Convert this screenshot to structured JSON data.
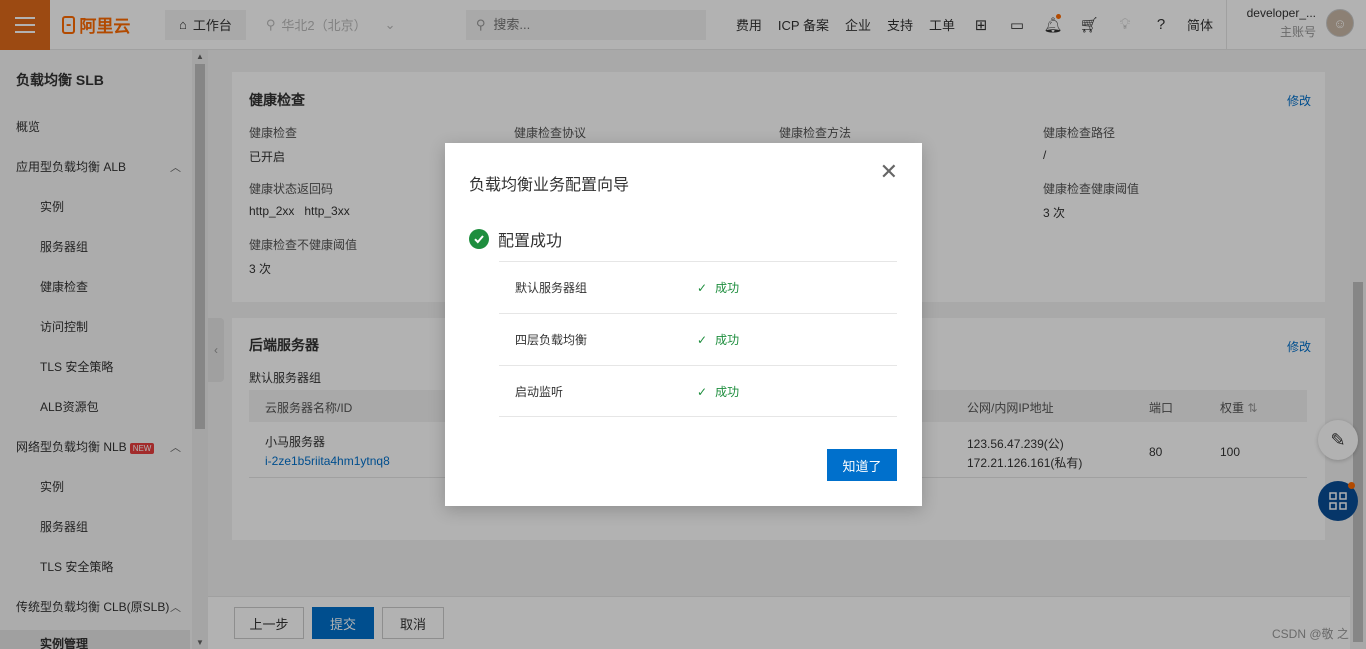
{
  "topbar": {
    "logo_text": "阿里云",
    "workbench_label": "工作台",
    "region_label": "华北2（北京）",
    "search_placeholder": "搜索...",
    "links": [
      "费用",
      "ICP 备案",
      "企业",
      "支持",
      "工单"
    ],
    "lang_label": "简体",
    "username": "developer_...",
    "account_type": "主账号",
    "accent_color": "#e06a1b"
  },
  "sidebar": {
    "title": "负载均衡 SLB",
    "overview": "概览",
    "alb_group": "应用型负载均衡 ALB",
    "alb_items": [
      "实例",
      "服务器组",
      "健康检查",
      "访问控制",
      "TLS 安全策略",
      "ALB资源包"
    ],
    "nlb_group": "网络型负载均衡 NLB",
    "nlb_badge": "NEW",
    "nlb_items": [
      "实例",
      "服务器组",
      "TLS 安全策略"
    ],
    "clb_group": "传统型负载均衡 CLB(原SLB)",
    "clb_active_item": "实例管理"
  },
  "health": {
    "title": "健康检查",
    "edit": "修改",
    "fields": [
      {
        "label": "健康检查",
        "value": "已开启"
      },
      {
        "label": "健康检查协议",
        "value": ""
      },
      {
        "label": "健康检查方法",
        "value": ""
      },
      {
        "label": "健康检查路径",
        "value": "/"
      },
      {
        "label": "健康状态返回码",
        "value": "http_2xx   http_3xx"
      },
      {
        "label": "健康检查健康阈值",
        "value": "3 次"
      },
      {
        "label": "健康检查不健康阈值",
        "value": "3 次"
      }
    ]
  },
  "backend": {
    "title": "后端服务器",
    "edit": "修改",
    "group_label": "默认服务器组",
    "columns": [
      "云服务器名称/ID",
      "公网/内网IP地址",
      "端口",
      "权重"
    ],
    "row": {
      "name": "小马服务器",
      "id": "i-2ze1b5riita4hm1ytnq8",
      "public_ip": "123.56.47.239(公)",
      "private_ip": "172.21.126.161(私有)",
      "port": "80",
      "weight": "100"
    }
  },
  "footer": {
    "prev": "上一步",
    "submit": "提交",
    "cancel": "取消"
  },
  "modal": {
    "title": "负载均衡业务配置向导",
    "success_title": "配置成功",
    "steps": [
      {
        "name": "默认服务器组",
        "status": "成功"
      },
      {
        "name": "四层负载均衡",
        "status": "成功"
      },
      {
        "name": "启动监听",
        "status": "成功"
      }
    ],
    "ok_button": "知道了",
    "success_color": "#1e8e3e"
  },
  "watermark": "CSDN @敬 之"
}
